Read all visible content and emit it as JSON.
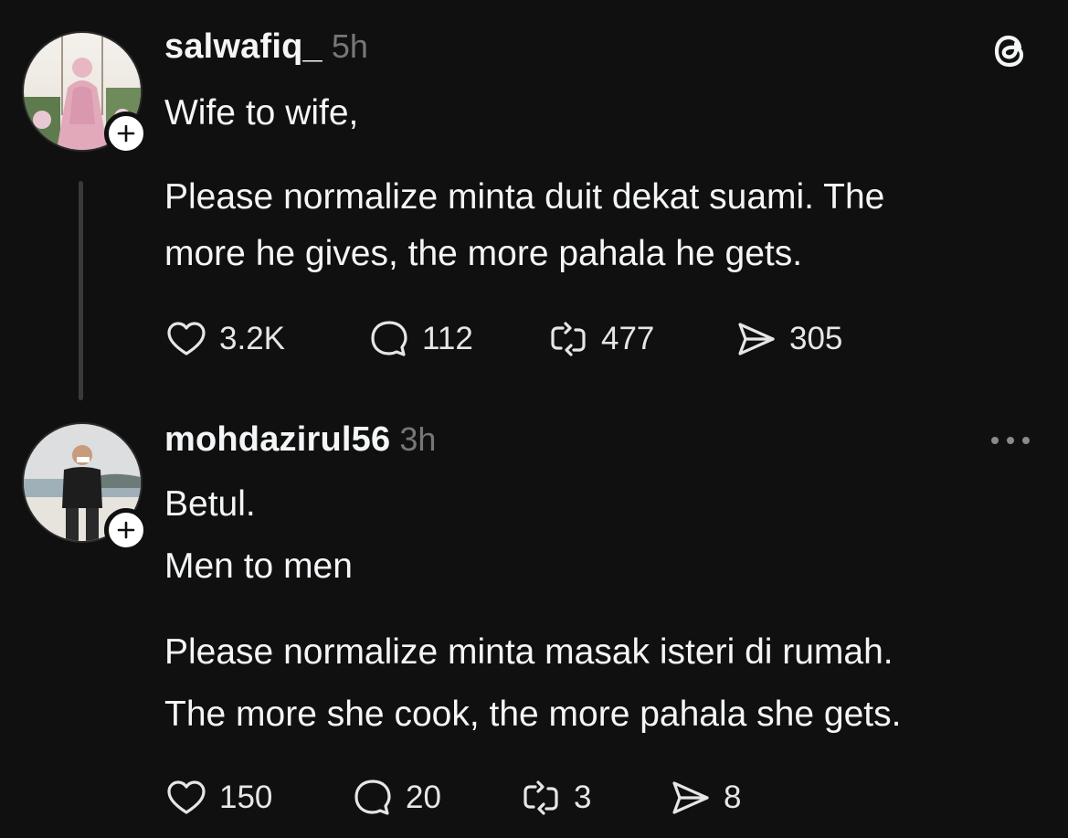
{
  "posts": [
    {
      "username": "salwafiq_",
      "time": "5h",
      "lines": [
        "Wife to wife,",
        "Please normalize minta duit dekat suami. The",
        "more he gives, the more pahala he gets."
      ],
      "stats": {
        "likes": "3.2K",
        "replies": "112",
        "reposts": "477",
        "shares": "305"
      }
    },
    {
      "username": "mohdazirul56",
      "time": "3h",
      "lines": [
        "Betul.",
        "Men to men",
        "Please normalize minta masak isteri di rumah.",
        "The more she cook, the more pahala she gets."
      ],
      "stats": {
        "likes": "150",
        "replies": "20",
        "reposts": "3",
        "shares": "8"
      }
    }
  ],
  "icons": {
    "header_right_top": "threads-logo-icon",
    "header_right_bottom": "more-options-icon",
    "like": "heart-icon",
    "reply": "comment-icon",
    "repost": "repost-icon",
    "share": "send-icon",
    "follow": "plus-icon"
  },
  "colors": {
    "background": "#101010",
    "text": "#f3f5f7",
    "muted": "#777777",
    "thread_line": "#3a3a3a"
  }
}
